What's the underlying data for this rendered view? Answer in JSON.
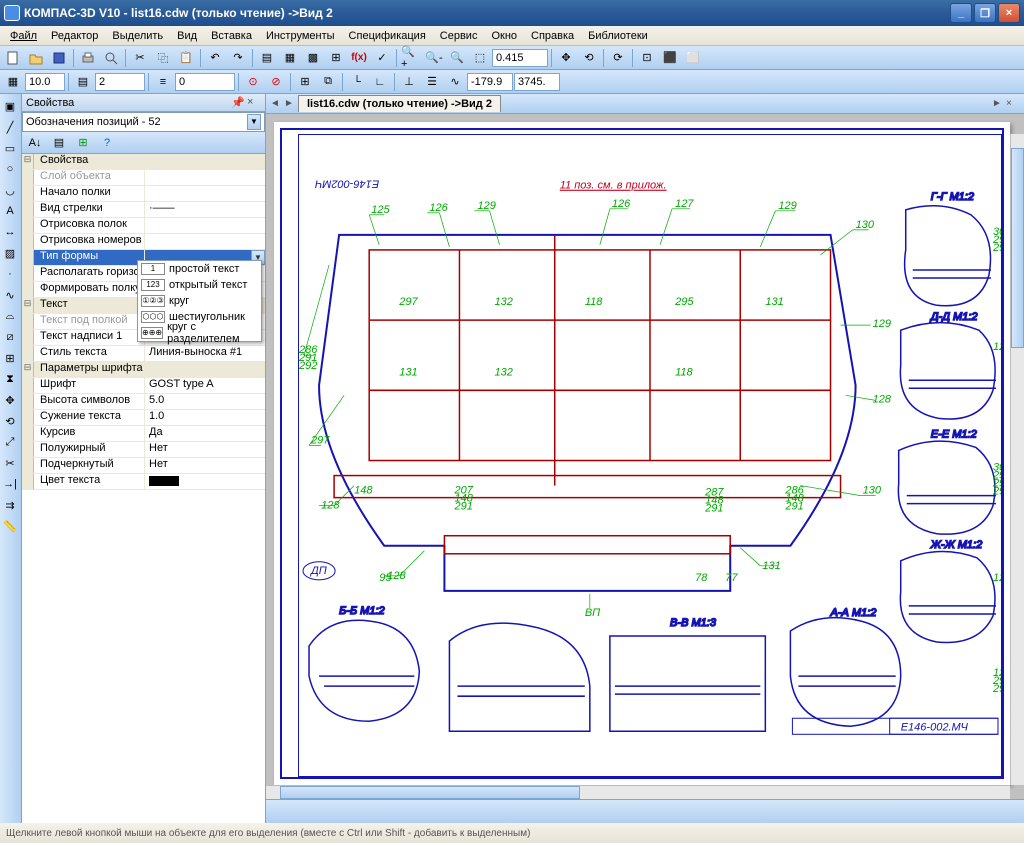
{
  "window": {
    "title": "КОМПАС-3D V10 - list16.cdw (только чтение) ->Вид 2"
  },
  "menu": [
    "Файл",
    "Редактор",
    "Выделить",
    "Вид",
    "Вставка",
    "Инструменты",
    "Спецификация",
    "Сервис",
    "Окно",
    "Справка",
    "Библиотеки"
  ],
  "toolbar1": {
    "zoom": "0.415"
  },
  "toolbar2": {
    "val1": "10.0",
    "val2": "2",
    "val3": "0",
    "coordX": "-179.9",
    "coordY": "3745."
  },
  "properties": {
    "title": "Свойства",
    "combo": "Обозначения позиций - 52",
    "sections": {
      "main": "Свойства",
      "text": "Текст",
      "font": "Параметры шрифта"
    },
    "rows": [
      {
        "k": "Слой объекта",
        "v": "",
        "disabled": true
      },
      {
        "k": "Начало полки",
        "v": ""
      },
      {
        "k": "Вид стрелки",
        "v": "·——"
      },
      {
        "k": "Отрисовка полок",
        "v": ""
      },
      {
        "k": "Отрисовка номеров ...",
        "v": ""
      },
      {
        "k": "Тип формы",
        "v": "",
        "selected": true
      },
      {
        "k": "Располагать горизо...",
        "v": ""
      },
      {
        "k": "Формировать полку",
        "v": ""
      },
      {
        "k": "Текст под полкой",
        "v": "",
        "disabled": true
      },
      {
        "k": "Текст надписи 1",
        "v": ""
      },
      {
        "k": "Стиль текста",
        "v": "Линия-выноска #1"
      },
      {
        "k": "Шрифт",
        "v": "GOST type A"
      },
      {
        "k": "Высота символов",
        "v": "5.0"
      },
      {
        "k": "Сужение текста",
        "v": "1.0"
      },
      {
        "k": "Курсив",
        "v": "Да"
      },
      {
        "k": "Полужирный",
        "v": "Нет"
      },
      {
        "k": "Подчеркнутый",
        "v": "Нет"
      },
      {
        "k": "Цвет текста",
        "v": "",
        "swatch": true
      }
    ],
    "dropdown": [
      {
        "icon": "1",
        "label": "простой текст"
      },
      {
        "icon": "123",
        "label": "открытый текст"
      },
      {
        "icon": "①②③",
        "label": "круг"
      },
      {
        "icon": "⬡⬡⬡",
        "label": "шестиугольник"
      },
      {
        "icon": "⊕⊕⊕",
        "label": "круг с разделителем"
      }
    ]
  },
  "doc": {
    "tab": "list16.cdw (только чтение) ->Вид 2",
    "title_block_code": "E146-002.МЧ",
    "top_left_code": "E146-002МЧ"
  },
  "status": "Щелкните левой кнопкой мыши на объекте для его выделения (вместе с Ctrl или Shift - добавить к выделенным)"
}
